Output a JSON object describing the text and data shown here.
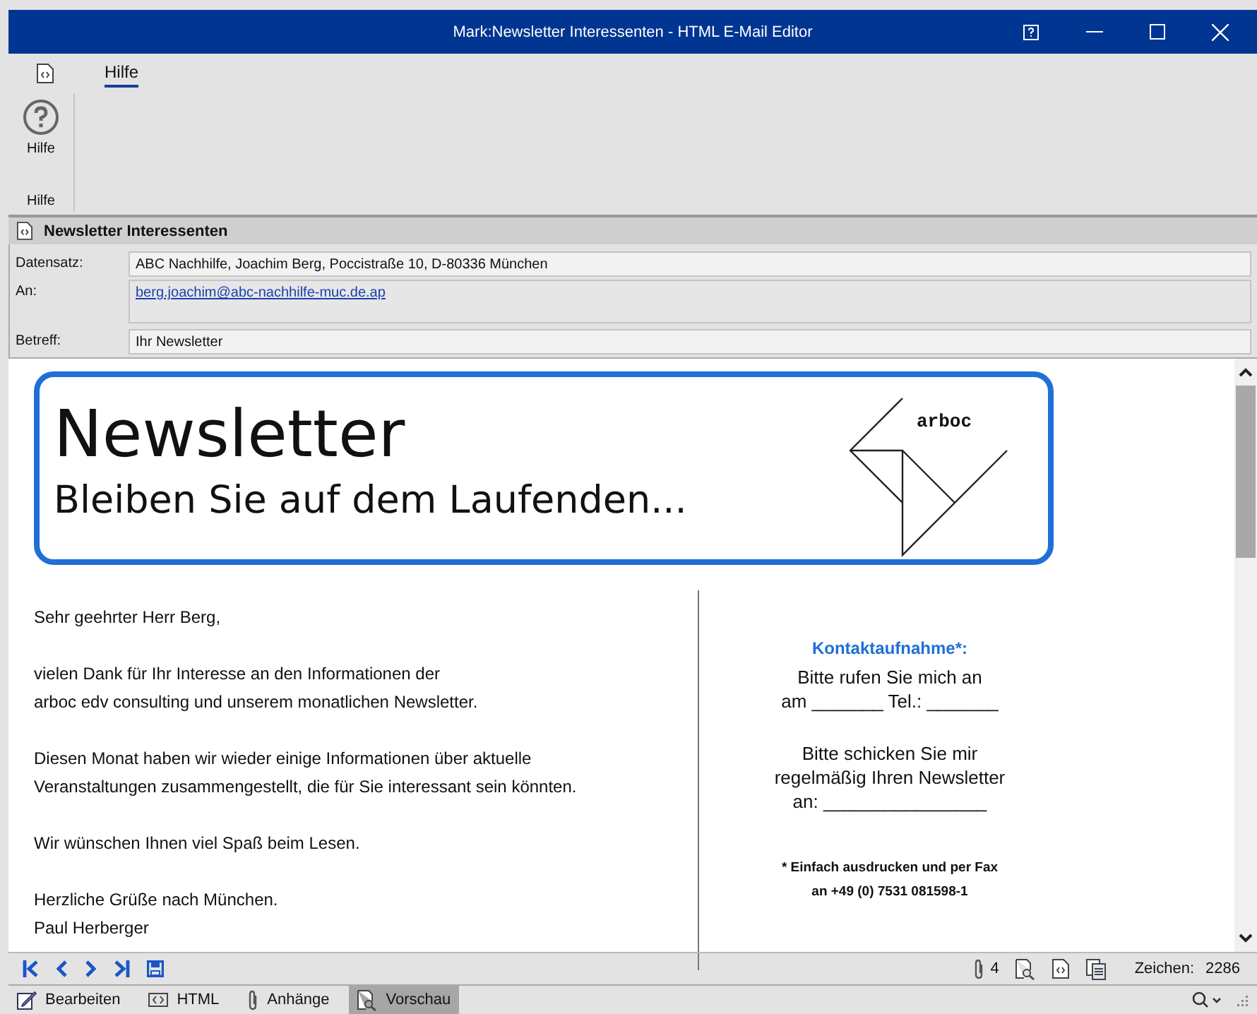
{
  "window": {
    "title": "Mark:Newsletter Interessenten - HTML E-Mail Editor"
  },
  "ribbon": {
    "tabs": [
      {
        "label": "Hilfe",
        "selected": true
      }
    ],
    "buttons": [
      {
        "label": "Hilfe"
      }
    ],
    "group_label": "Hilfe"
  },
  "form": {
    "title": "Newsletter Interessenten",
    "fields": [
      {
        "label": "Datensatz:",
        "value": "ABC Nachhilfe,  Joachim Berg,  Poccistraße 10,  D-80336 München",
        "kind": "text"
      },
      {
        "label": "An:",
        "value": "berg.joachim@abc-nachhilfe-muc.de.ap",
        "kind": "link"
      },
      {
        "label": "Betreff:",
        "value": "Ihr Newsletter",
        "kind": "text"
      }
    ]
  },
  "newsletter": {
    "title": "Newsletter",
    "subtitle": "Bleiben Sie auf dem Laufenden...",
    "logo_text": "arboc",
    "letter": [
      [
        "Sehr geehrter Herr Berg,"
      ],
      [
        "vielen Dank für Ihr Interesse an den Informationen der",
        "arboc edv consulting und unserem monatlichen Newsletter."
      ],
      [
        "Diesen Monat haben wir wieder einige Informationen über aktuelle",
        "Veranstaltungen zusammengestellt, die für Sie interessant sein könnten."
      ],
      [
        "Wir wünschen Ihnen viel Spaß beim Lesen."
      ],
      [
        "Herzliche Grüße nach München.",
        "Paul Herberger"
      ]
    ],
    "contact": {
      "heading": "Kontaktaufnahme*:",
      "paragraphs": [
        [
          "Bitte rufen Sie mich an",
          "am _______ Tel.: _______"
        ],
        [
          "Bitte schicken Sie mir",
          "regelmäßig Ihren Newsletter",
          "an: ________________"
        ]
      ],
      "footnote": [
        "* Einfach ausdrucken und  per Fax",
        "an +49 (0) 7531 081598-1"
      ]
    }
  },
  "toolbar": {
    "attachment_count": "4",
    "char_label": "Zeichen:",
    "char_count": "2286"
  },
  "view_tabs": [
    {
      "label": "Bearbeiten",
      "kind": "edit",
      "selected": false
    },
    {
      "label": "HTML",
      "kind": "html",
      "selected": false
    },
    {
      "label": "Anhänge",
      "kind": "attach",
      "selected": false
    },
    {
      "label": "Vorschau",
      "kind": "preview",
      "selected": true
    }
  ]
}
